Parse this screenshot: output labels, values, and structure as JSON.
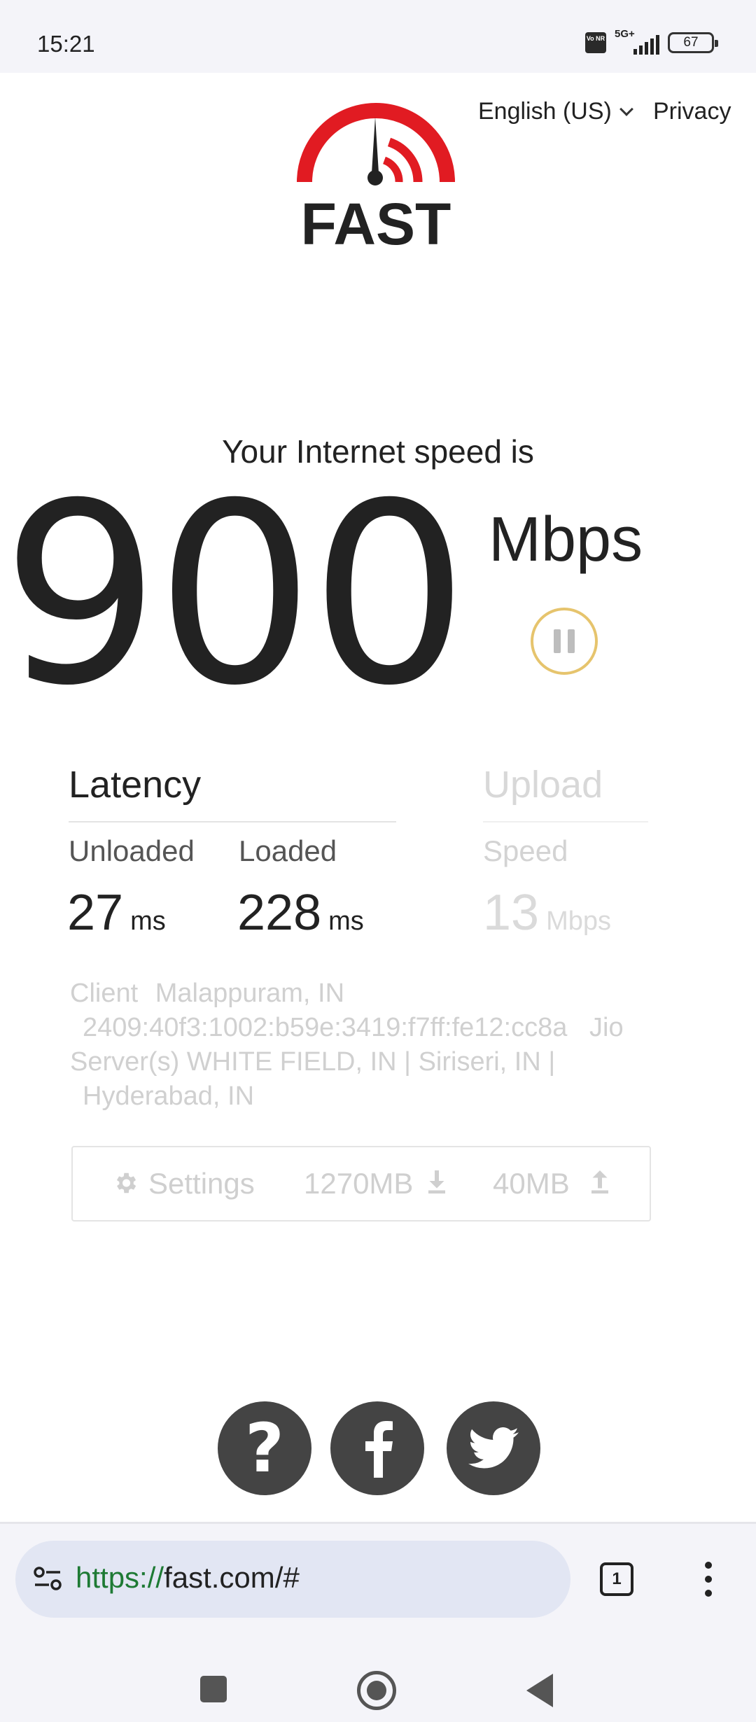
{
  "status_bar": {
    "time": "15:21",
    "volte_label": "Vo NR",
    "network": "5G+",
    "battery": "67"
  },
  "header": {
    "language": "English (US)",
    "privacy": "Privacy",
    "logo_text": "FAST",
    "logo_color": "#e11b22"
  },
  "speed": {
    "caption": "Your Internet speed is",
    "value": "900",
    "unit": "Mbps"
  },
  "latency": {
    "title": "Latency",
    "unloaded_label": "Unloaded",
    "unloaded_value": "27",
    "loaded_label": "Loaded",
    "loaded_value": "228",
    "unit": "ms"
  },
  "upload": {
    "title": "Upload",
    "speed_label": "Speed",
    "value": "13",
    "unit": "Mbps"
  },
  "info": {
    "client_label": "Client",
    "client_location": "Malappuram, IN",
    "client_ip": "2409:40f3:1002:b59e:3419:f7ff:fe12:cc8a",
    "isp": "Jio",
    "servers_label": "Server(s)",
    "servers_line1": "WHITE FIELD, IN  |  Siriseri, IN  |",
    "servers_line2": "Hyderabad, IN"
  },
  "settings_bar": {
    "settings_label": "Settings",
    "download_size": "1270MB",
    "upload_size": "40MB"
  },
  "social": {
    "help_icon": "question-icon",
    "facebook_icon": "facebook-icon",
    "twitter_icon": "twitter-icon"
  },
  "browser": {
    "url_scheme": "https://",
    "url_rest": "fast.com/#",
    "tab_count": "1"
  }
}
